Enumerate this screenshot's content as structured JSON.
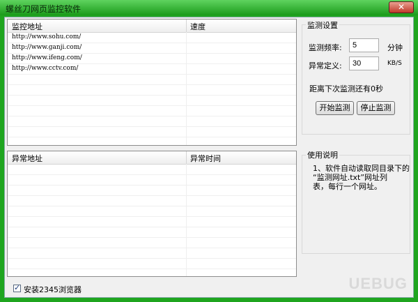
{
  "window": {
    "title": "螺丝刀网页监控软件",
    "close_label": "✕"
  },
  "monitor_list": {
    "headers": [
      "监控地址",
      "速度"
    ],
    "rows": [
      {
        "url": "http://www.sohu.com/",
        "speed": ""
      },
      {
        "url": "http://www.ganji.com/",
        "speed": ""
      },
      {
        "url": "http://www.ifeng.com/",
        "speed": ""
      },
      {
        "url": "http://www.cctv.com/",
        "speed": ""
      }
    ]
  },
  "abnormal_list": {
    "headers": [
      "异常地址",
      "异常时间"
    ],
    "rows": []
  },
  "settings": {
    "group_title": "监测设置",
    "frequency_label": "监测频率:",
    "frequency_value": "5",
    "frequency_unit": "分钟",
    "abnormal_label": "异常定义:",
    "abnormal_value": "30",
    "abnormal_unit": "KB/S",
    "countdown_text": "距离下次监测还有0秒",
    "start_button": "开始监测",
    "stop_button": "停止监测"
  },
  "instructions": {
    "group_title": "使用说明",
    "lines": [
      "1、软件自动读取同目录下的",
      "“监测网址.txt”网址列",
      "表，每行一个网址。"
    ]
  },
  "footer": {
    "install_checkbox_label": "安装2345浏览器",
    "install_checked": true
  },
  "watermark": "UEBUG"
}
